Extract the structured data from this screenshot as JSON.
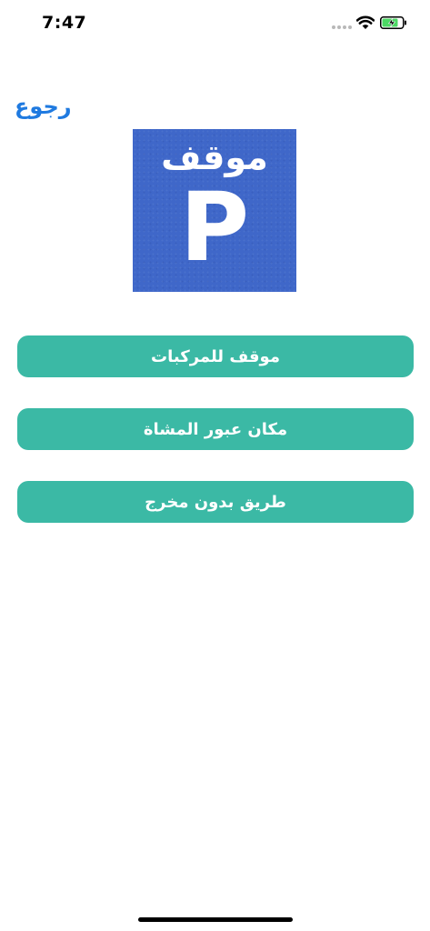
{
  "status_bar": {
    "time": "7:47",
    "icons": [
      "signal-icon",
      "wifi-icon",
      "battery-charging-icon"
    ],
    "battery_color": "#4cd964"
  },
  "nav": {
    "back_label": "رجوع",
    "accent_color": "#1f7ae0"
  },
  "sign": {
    "word": "موقف",
    "letter": "P",
    "background_color": "#3f67c9"
  },
  "options": [
    {
      "label": "موقف للمركبات"
    },
    {
      "label": "مكان عبور المشاة"
    },
    {
      "label": "طريق بدون مخرج"
    }
  ],
  "button_color": "#3bb9a5"
}
